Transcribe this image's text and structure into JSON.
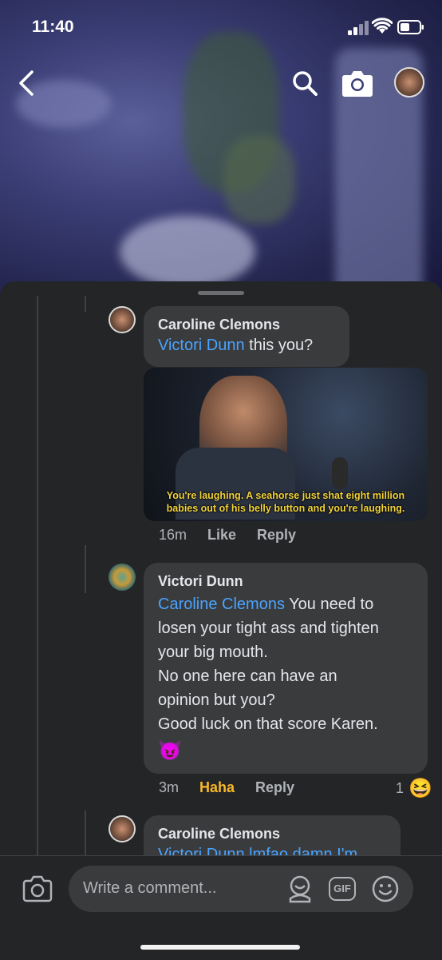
{
  "status_bar": {
    "time": "11:40"
  },
  "comments": [
    {
      "author": "Caroline Clemons",
      "mention": "Victori Dunn",
      "text": " this you?",
      "gif_caption_line1": "You're laughing. A seahorse just shat eight million",
      "gif_caption_line2": "babies out of his belly button and you're laughing.",
      "time": "16m",
      "like_label": "Like",
      "reply_label": "Reply"
    },
    {
      "author": "Victori Dunn",
      "mention": "Caroline Clemons",
      "line1": " You need to",
      "line2": "losen your tight ass and tighten",
      "line3": "your big mouth.",
      "line4": "No one here can have an",
      "line5": "opinion but you?",
      "line6": "Good luck on that score Karen.",
      "emoji": "😈",
      "time": "3m",
      "reaction_label": "Haha",
      "reply_label": "Reply",
      "reaction_count": "1",
      "reaction_emoji": "😆"
    },
    {
      "author": "Caroline Clemons",
      "preview": "Victori Dunn lmfao damn I'm"
    }
  ],
  "composer": {
    "placeholder": "Write a comment...",
    "gif_label": "GIF"
  },
  "colors": {
    "mention": "#4aa3ff",
    "haha": "#f7b928",
    "bubble": "#3a3b3c",
    "sheet": "#242526"
  }
}
